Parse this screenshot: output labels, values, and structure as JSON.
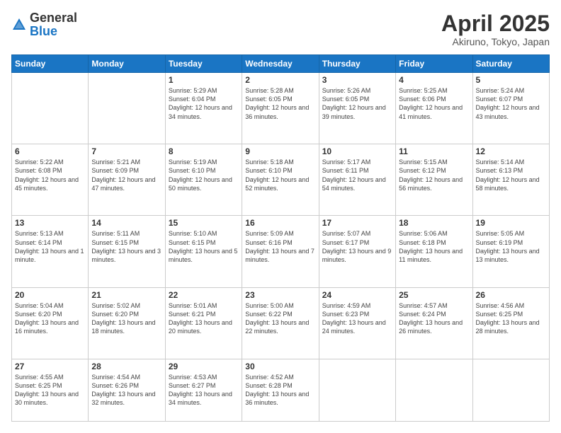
{
  "logo": {
    "general": "General",
    "blue": "Blue"
  },
  "header": {
    "title": "April 2025",
    "subtitle": "Akiruno, Tokyo, Japan"
  },
  "weekdays": [
    "Sunday",
    "Monday",
    "Tuesday",
    "Wednesday",
    "Thursday",
    "Friday",
    "Saturday"
  ],
  "weeks": [
    [
      {
        "day": "",
        "info": ""
      },
      {
        "day": "",
        "info": ""
      },
      {
        "day": "1",
        "info": "Sunrise: 5:29 AM\nSunset: 6:04 PM\nDaylight: 12 hours and 34 minutes."
      },
      {
        "day": "2",
        "info": "Sunrise: 5:28 AM\nSunset: 6:05 PM\nDaylight: 12 hours and 36 minutes."
      },
      {
        "day": "3",
        "info": "Sunrise: 5:26 AM\nSunset: 6:05 PM\nDaylight: 12 hours and 39 minutes."
      },
      {
        "day": "4",
        "info": "Sunrise: 5:25 AM\nSunset: 6:06 PM\nDaylight: 12 hours and 41 minutes."
      },
      {
        "day": "5",
        "info": "Sunrise: 5:24 AM\nSunset: 6:07 PM\nDaylight: 12 hours and 43 minutes."
      }
    ],
    [
      {
        "day": "6",
        "info": "Sunrise: 5:22 AM\nSunset: 6:08 PM\nDaylight: 12 hours and 45 minutes."
      },
      {
        "day": "7",
        "info": "Sunrise: 5:21 AM\nSunset: 6:09 PM\nDaylight: 12 hours and 47 minutes."
      },
      {
        "day": "8",
        "info": "Sunrise: 5:19 AM\nSunset: 6:10 PM\nDaylight: 12 hours and 50 minutes."
      },
      {
        "day": "9",
        "info": "Sunrise: 5:18 AM\nSunset: 6:10 PM\nDaylight: 12 hours and 52 minutes."
      },
      {
        "day": "10",
        "info": "Sunrise: 5:17 AM\nSunset: 6:11 PM\nDaylight: 12 hours and 54 minutes."
      },
      {
        "day": "11",
        "info": "Sunrise: 5:15 AM\nSunset: 6:12 PM\nDaylight: 12 hours and 56 minutes."
      },
      {
        "day": "12",
        "info": "Sunrise: 5:14 AM\nSunset: 6:13 PM\nDaylight: 12 hours and 58 minutes."
      }
    ],
    [
      {
        "day": "13",
        "info": "Sunrise: 5:13 AM\nSunset: 6:14 PM\nDaylight: 13 hours and 1 minute."
      },
      {
        "day": "14",
        "info": "Sunrise: 5:11 AM\nSunset: 6:15 PM\nDaylight: 13 hours and 3 minutes."
      },
      {
        "day": "15",
        "info": "Sunrise: 5:10 AM\nSunset: 6:15 PM\nDaylight: 13 hours and 5 minutes."
      },
      {
        "day": "16",
        "info": "Sunrise: 5:09 AM\nSunset: 6:16 PM\nDaylight: 13 hours and 7 minutes."
      },
      {
        "day": "17",
        "info": "Sunrise: 5:07 AM\nSunset: 6:17 PM\nDaylight: 13 hours and 9 minutes."
      },
      {
        "day": "18",
        "info": "Sunrise: 5:06 AM\nSunset: 6:18 PM\nDaylight: 13 hours and 11 minutes."
      },
      {
        "day": "19",
        "info": "Sunrise: 5:05 AM\nSunset: 6:19 PM\nDaylight: 13 hours and 13 minutes."
      }
    ],
    [
      {
        "day": "20",
        "info": "Sunrise: 5:04 AM\nSunset: 6:20 PM\nDaylight: 13 hours and 16 minutes."
      },
      {
        "day": "21",
        "info": "Sunrise: 5:02 AM\nSunset: 6:20 PM\nDaylight: 13 hours and 18 minutes."
      },
      {
        "day": "22",
        "info": "Sunrise: 5:01 AM\nSunset: 6:21 PM\nDaylight: 13 hours and 20 minutes."
      },
      {
        "day": "23",
        "info": "Sunrise: 5:00 AM\nSunset: 6:22 PM\nDaylight: 13 hours and 22 minutes."
      },
      {
        "day": "24",
        "info": "Sunrise: 4:59 AM\nSunset: 6:23 PM\nDaylight: 13 hours and 24 minutes."
      },
      {
        "day": "25",
        "info": "Sunrise: 4:57 AM\nSunset: 6:24 PM\nDaylight: 13 hours and 26 minutes."
      },
      {
        "day": "26",
        "info": "Sunrise: 4:56 AM\nSunset: 6:25 PM\nDaylight: 13 hours and 28 minutes."
      }
    ],
    [
      {
        "day": "27",
        "info": "Sunrise: 4:55 AM\nSunset: 6:25 PM\nDaylight: 13 hours and 30 minutes."
      },
      {
        "day": "28",
        "info": "Sunrise: 4:54 AM\nSunset: 6:26 PM\nDaylight: 13 hours and 32 minutes."
      },
      {
        "day": "29",
        "info": "Sunrise: 4:53 AM\nSunset: 6:27 PM\nDaylight: 13 hours and 34 minutes."
      },
      {
        "day": "30",
        "info": "Sunrise: 4:52 AM\nSunset: 6:28 PM\nDaylight: 13 hours and 36 minutes."
      },
      {
        "day": "",
        "info": ""
      },
      {
        "day": "",
        "info": ""
      },
      {
        "day": "",
        "info": ""
      }
    ]
  ]
}
